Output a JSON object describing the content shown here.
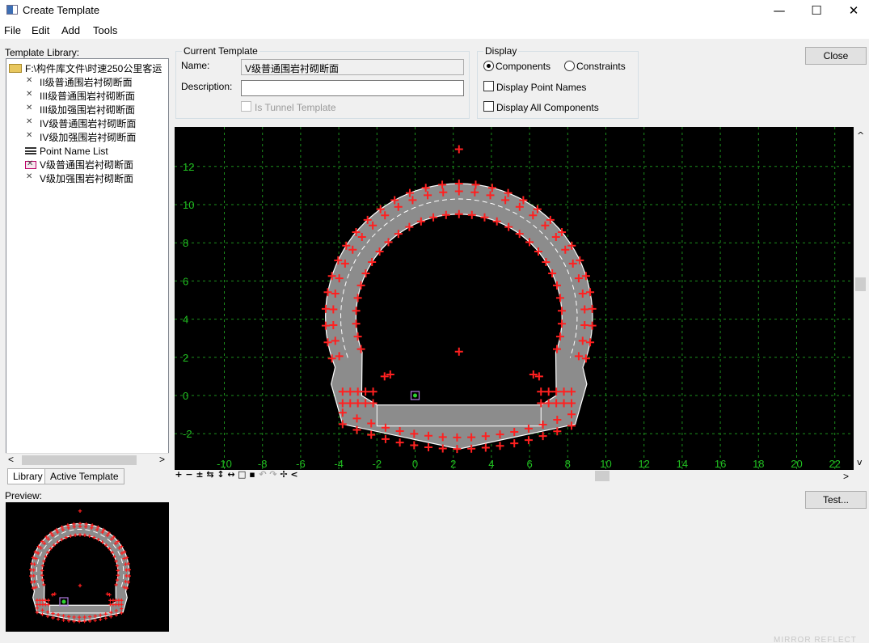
{
  "window": {
    "title": "Create Template",
    "minimize": "—",
    "maximize": "☐",
    "close": "✕"
  },
  "menu": [
    "File",
    "Edit",
    "Add",
    "Tools"
  ],
  "library": {
    "label": "Template Library:",
    "root": "F:\\构件库文件\\时速250公里客运",
    "items": [
      {
        "label": "II级普通围岩衬砌断面",
        "icon": "cross-section-icon"
      },
      {
        "label": "III级普通围岩衬砌断面",
        "icon": "cross-section-icon"
      },
      {
        "label": "III级加强围岩衬砌断面",
        "icon": "cross-section-icon"
      },
      {
        "label": "IV级普通围岩衬砌断面",
        "icon": "cross-section-icon"
      },
      {
        "label": "IV级加强围岩衬砌断面",
        "icon": "cross-section-icon"
      },
      {
        "label": "Point Name List",
        "icon": "list-icon"
      },
      {
        "label": "V级普通围岩衬砌断面",
        "icon": "cross-section-icon"
      },
      {
        "label": "V级加强围岩衬砌断面",
        "icon": "cross-section-icon"
      }
    ],
    "tabs": [
      "Library",
      "Active Template"
    ]
  },
  "current_template": {
    "group": "Current Template",
    "name_label": "Name:",
    "name_value": "V级普通围岩衬砌断面",
    "description_label": "Description:",
    "description_value": "",
    "tunnel_label": "Is Tunnel Template"
  },
  "display": {
    "group": "Display",
    "components": "Components",
    "constraints": "Constraints",
    "point_names": "Display Point Names",
    "all_components": "Display All Components"
  },
  "buttons": {
    "close": "Close",
    "test": "Test..."
  },
  "preview_label": "Preview:",
  "canvas": {
    "x_ticks": [
      "-10",
      "-8",
      "-6",
      "-4",
      "-2",
      "0",
      "2",
      "4",
      "6",
      "8",
      "10",
      "12",
      "14",
      "16",
      "18",
      "20",
      "22"
    ],
    "y_ticks": [
      "12",
      "10",
      "8",
      "6",
      "4",
      "2",
      "0",
      "-2"
    ],
    "grid_color": "#1c8f1c",
    "axis_label_color": "#21c021",
    "marker_color": "#ff2020"
  },
  "watermark": "MIRROR    REFLECT"
}
